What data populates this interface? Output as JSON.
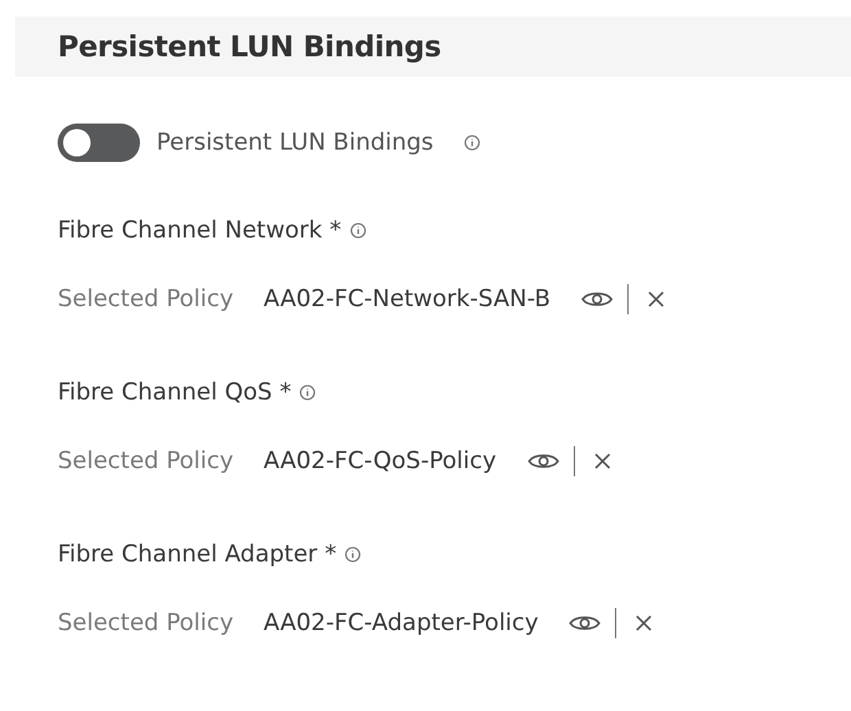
{
  "section": {
    "title": "Persistent LUN Bindings"
  },
  "toggle": {
    "label": "Persistent LUN Bindings",
    "on": false
  },
  "policies": [
    {
      "label": "Fibre Channel Network *",
      "prefix": "Selected Policy",
      "value": "AA02-FC-Network-SAN-B"
    },
    {
      "label": "Fibre Channel QoS *",
      "prefix": "Selected Policy",
      "value": "AA02-FC-QoS-Policy"
    },
    {
      "label": "Fibre Channel Adapter *",
      "prefix": "Selected Policy",
      "value": "AA02-FC-Adapter-Policy"
    }
  ]
}
